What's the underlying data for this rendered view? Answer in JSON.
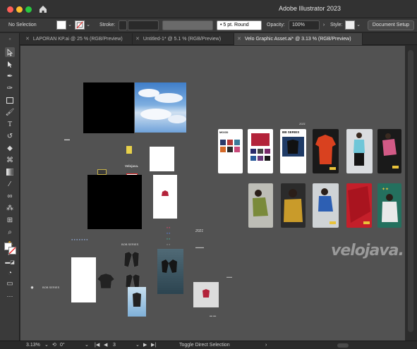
{
  "app": {
    "title": "Adobe Illustrator 2023",
    "colors": {
      "accent": "#4b8cff",
      "canvas": "#525252",
      "panel": "#3a3a3a"
    }
  },
  "control_bar": {
    "selection": "No Selection",
    "stroke_label": "Stroke:",
    "brush_label": "5 pt. Round",
    "opacity_label": "Opacity:",
    "opacity_value": "100%",
    "style_label": "Style:",
    "document_setup": "Document Setup"
  },
  "tabs": [
    {
      "label": "LAPORAN KP.ai @ 25 % (RGB/Preview)",
      "active": false
    },
    {
      "label": "Untitled-1* @ 5.1 % (RGB/Preview)",
      "active": false
    },
    {
      "label": "Velo Graphic Asset.ai* @ 3.13 % (RGB/Preview)",
      "active": true
    }
  ],
  "tools": [
    "selection-tool",
    "direct-selection-tool",
    "pen-tool",
    "curvature-tool",
    "rectangle-tool",
    "paintbrush-tool",
    "type-tool",
    "rotate-tool",
    "eraser-tool",
    "width-tool",
    "gradient-tool",
    "eyedropper-tool",
    "blend-tool",
    "symbol-sprayer-tool",
    "artboard-tool",
    "zoom-tool",
    "hand-tool"
  ],
  "artwork": {
    "mood_label": "MOOD",
    "bb_series_label": "BB SERIES",
    "year_top": "2021",
    "year_mid": "2021",
    "bob_series_a": "BOB SERIES",
    "bob_series_b": "BOB SERIES",
    "velojava_small": "Velojava.",
    "logo_text": "velojava."
  },
  "status": {
    "zoom": "3.13%",
    "rotation": "0°",
    "artboard": "3",
    "tool_hint": "Toggle Direct Selection"
  }
}
